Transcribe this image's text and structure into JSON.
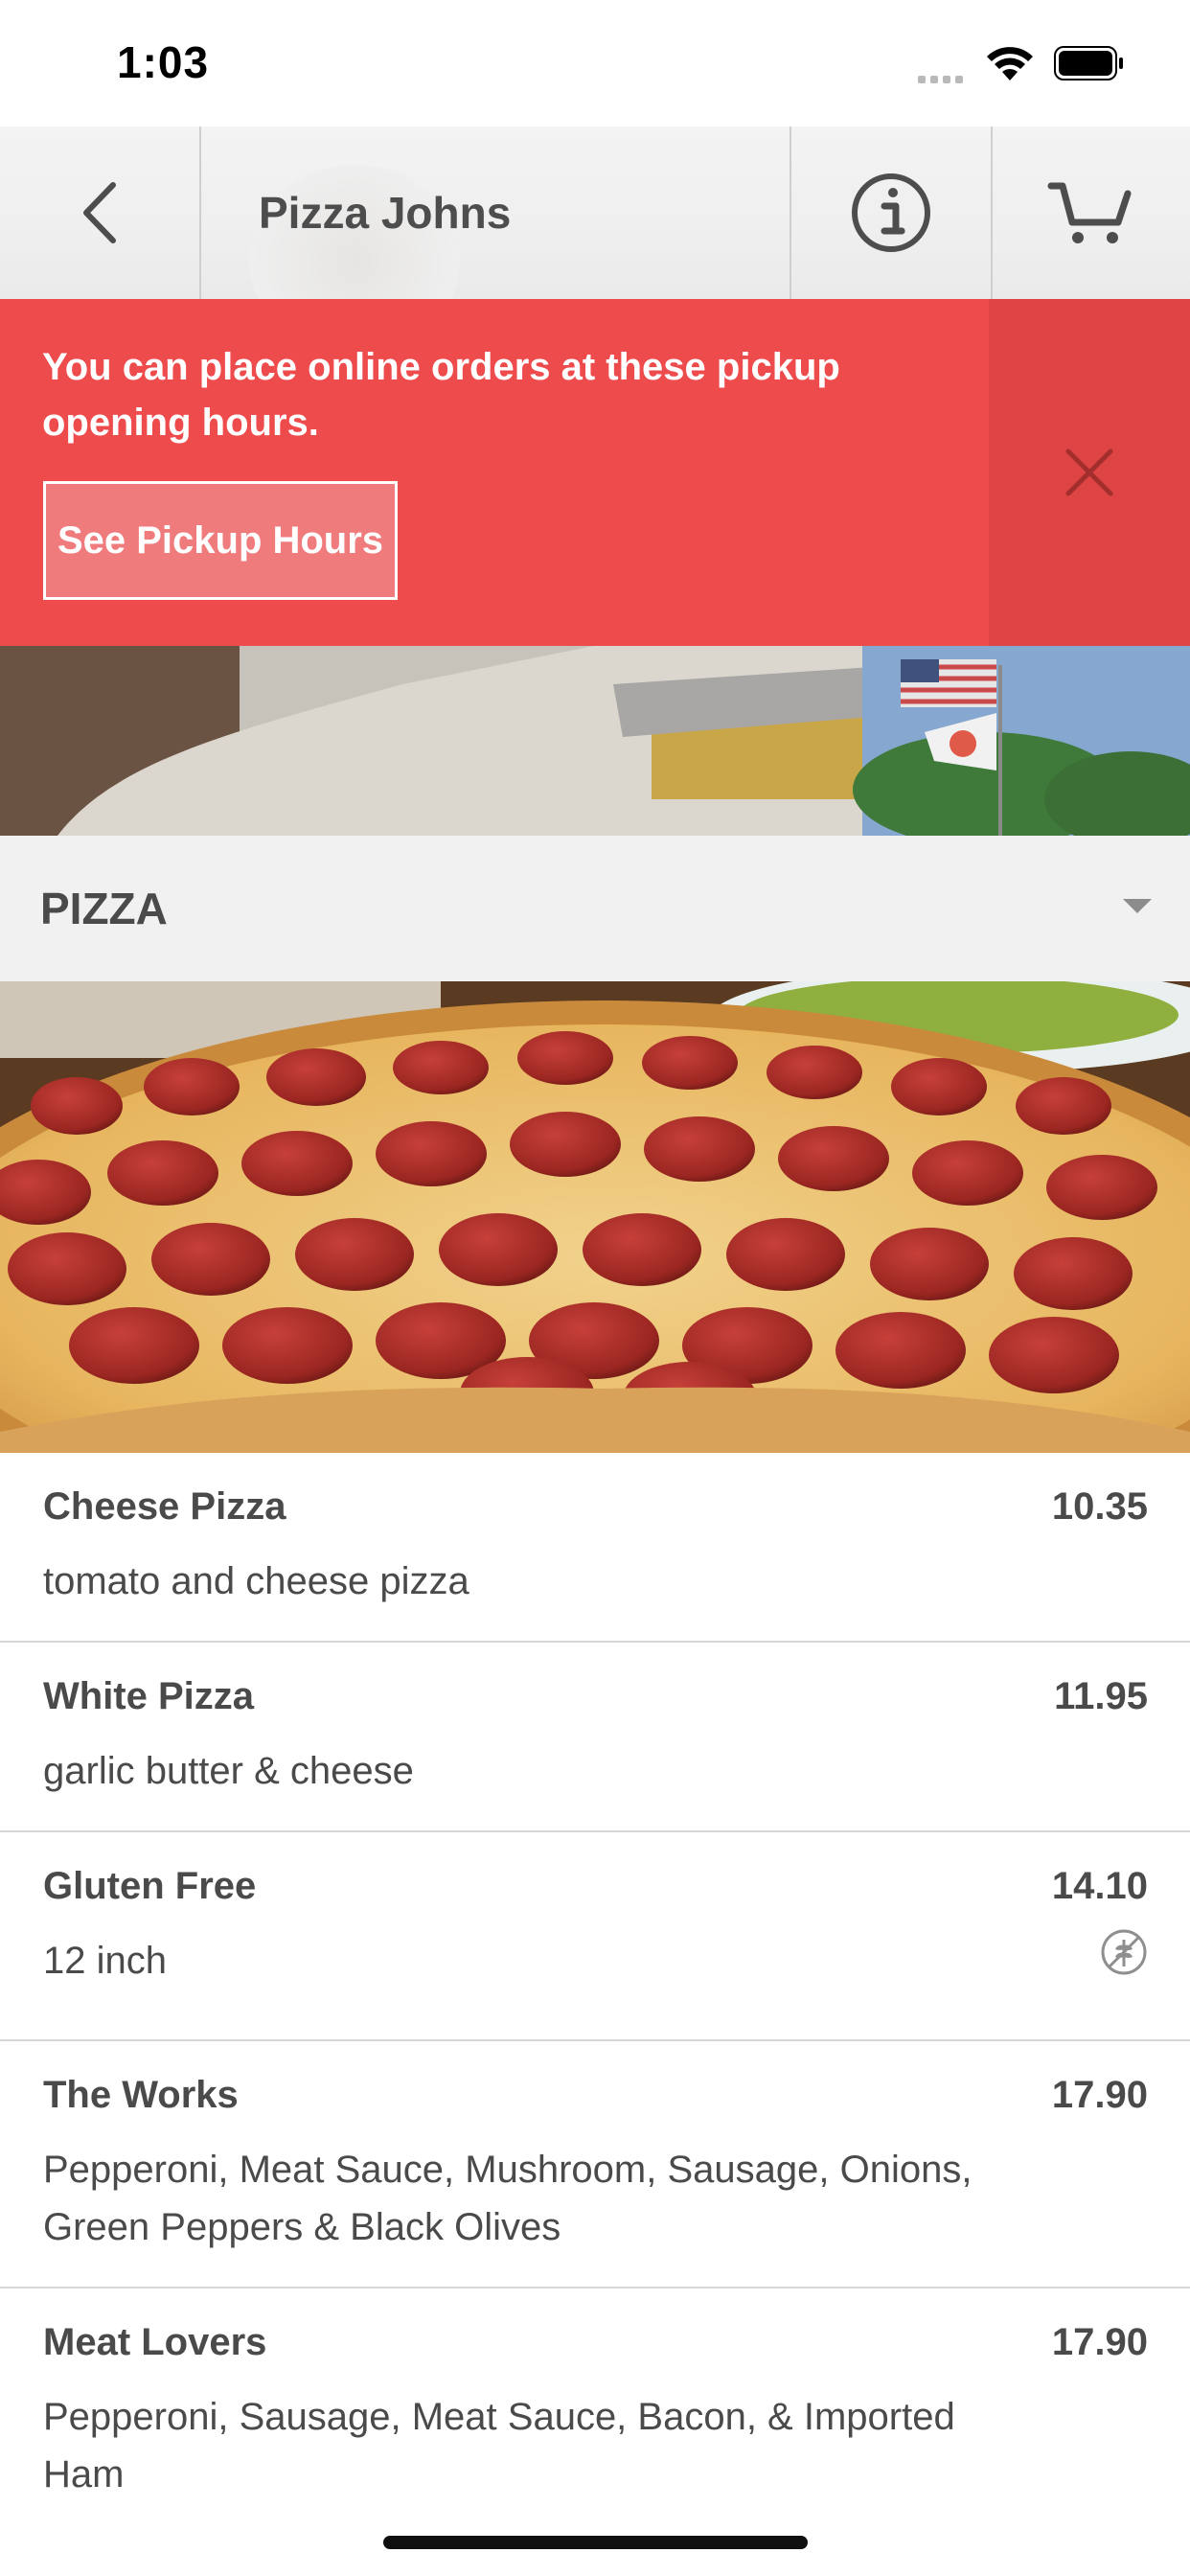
{
  "status_bar": {
    "time": "1:03"
  },
  "header": {
    "title": "Pizza Johns"
  },
  "banner": {
    "message": "You can place online orders at these pickup opening hours.",
    "button_label": "See Pickup Hours"
  },
  "category": {
    "label": "PIZZA"
  },
  "menu": {
    "items": [
      {
        "name": "Cheese Pizza",
        "price": "10.35",
        "description": "tomato and cheese pizza"
      },
      {
        "name": "White Pizza",
        "price": "11.95",
        "description": "garlic butter & cheese"
      },
      {
        "name": "Gluten Free",
        "price": "14.10",
        "description": "12 inch",
        "icon": "gluten-free-icon"
      },
      {
        "name": "The Works",
        "price": "17.90",
        "description": "Pepperoni, Meat Sauce, Mushroom, Sausage, Onions, Green Peppers & Black Olives"
      },
      {
        "name": "Meat Lovers",
        "price": "17.90",
        "description": "Pepperoni, Sausage, Meat Sauce, Bacon, & Imported Ham"
      }
    ]
  },
  "colors": {
    "banner_bg": "#ee4b4d",
    "banner_close_bg": "#de4444",
    "text": "#4a4a4a",
    "category_bg": "#f1f1f1"
  },
  "icons": {
    "back": "chevron-left-icon",
    "info": "info-icon",
    "cart": "cart-icon",
    "close": "close-icon",
    "dropdown": "caret-down-icon"
  }
}
